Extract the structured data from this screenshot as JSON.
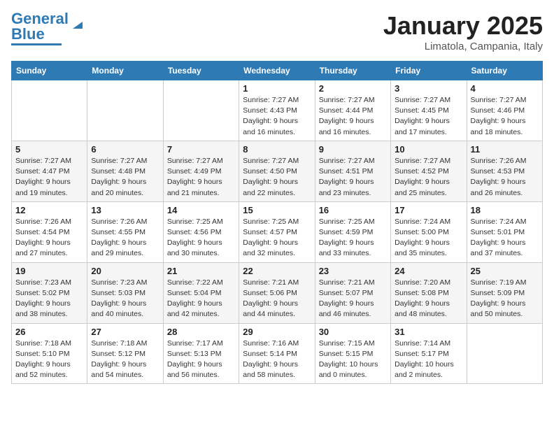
{
  "header": {
    "logo_line1": "General",
    "logo_line2": "Blue",
    "month": "January 2025",
    "location": "Limatola, Campania, Italy"
  },
  "weekdays": [
    "Sunday",
    "Monday",
    "Tuesday",
    "Wednesday",
    "Thursday",
    "Friday",
    "Saturday"
  ],
  "weeks": [
    [
      {
        "day": "",
        "sunrise": "",
        "sunset": "",
        "daylight": ""
      },
      {
        "day": "",
        "sunrise": "",
        "sunset": "",
        "daylight": ""
      },
      {
        "day": "",
        "sunrise": "",
        "sunset": "",
        "daylight": ""
      },
      {
        "day": "1",
        "sunrise": "Sunrise: 7:27 AM",
        "sunset": "Sunset: 4:43 PM",
        "daylight": "Daylight: 9 hours and 16 minutes."
      },
      {
        "day": "2",
        "sunrise": "Sunrise: 7:27 AM",
        "sunset": "Sunset: 4:44 PM",
        "daylight": "Daylight: 9 hours and 16 minutes."
      },
      {
        "day": "3",
        "sunrise": "Sunrise: 7:27 AM",
        "sunset": "Sunset: 4:45 PM",
        "daylight": "Daylight: 9 hours and 17 minutes."
      },
      {
        "day": "4",
        "sunrise": "Sunrise: 7:27 AM",
        "sunset": "Sunset: 4:46 PM",
        "daylight": "Daylight: 9 hours and 18 minutes."
      }
    ],
    [
      {
        "day": "5",
        "sunrise": "Sunrise: 7:27 AM",
        "sunset": "Sunset: 4:47 PM",
        "daylight": "Daylight: 9 hours and 19 minutes."
      },
      {
        "day": "6",
        "sunrise": "Sunrise: 7:27 AM",
        "sunset": "Sunset: 4:48 PM",
        "daylight": "Daylight: 9 hours and 20 minutes."
      },
      {
        "day": "7",
        "sunrise": "Sunrise: 7:27 AM",
        "sunset": "Sunset: 4:49 PM",
        "daylight": "Daylight: 9 hours and 21 minutes."
      },
      {
        "day": "8",
        "sunrise": "Sunrise: 7:27 AM",
        "sunset": "Sunset: 4:50 PM",
        "daylight": "Daylight: 9 hours and 22 minutes."
      },
      {
        "day": "9",
        "sunrise": "Sunrise: 7:27 AM",
        "sunset": "Sunset: 4:51 PM",
        "daylight": "Daylight: 9 hours and 23 minutes."
      },
      {
        "day": "10",
        "sunrise": "Sunrise: 7:27 AM",
        "sunset": "Sunset: 4:52 PM",
        "daylight": "Daylight: 9 hours and 25 minutes."
      },
      {
        "day": "11",
        "sunrise": "Sunrise: 7:26 AM",
        "sunset": "Sunset: 4:53 PM",
        "daylight": "Daylight: 9 hours and 26 minutes."
      }
    ],
    [
      {
        "day": "12",
        "sunrise": "Sunrise: 7:26 AM",
        "sunset": "Sunset: 4:54 PM",
        "daylight": "Daylight: 9 hours and 27 minutes."
      },
      {
        "day": "13",
        "sunrise": "Sunrise: 7:26 AM",
        "sunset": "Sunset: 4:55 PM",
        "daylight": "Daylight: 9 hours and 29 minutes."
      },
      {
        "day": "14",
        "sunrise": "Sunrise: 7:25 AM",
        "sunset": "Sunset: 4:56 PM",
        "daylight": "Daylight: 9 hours and 30 minutes."
      },
      {
        "day": "15",
        "sunrise": "Sunrise: 7:25 AM",
        "sunset": "Sunset: 4:57 PM",
        "daylight": "Daylight: 9 hours and 32 minutes."
      },
      {
        "day": "16",
        "sunrise": "Sunrise: 7:25 AM",
        "sunset": "Sunset: 4:59 PM",
        "daylight": "Daylight: 9 hours and 33 minutes."
      },
      {
        "day": "17",
        "sunrise": "Sunrise: 7:24 AM",
        "sunset": "Sunset: 5:00 PM",
        "daylight": "Daylight: 9 hours and 35 minutes."
      },
      {
        "day": "18",
        "sunrise": "Sunrise: 7:24 AM",
        "sunset": "Sunset: 5:01 PM",
        "daylight": "Daylight: 9 hours and 37 minutes."
      }
    ],
    [
      {
        "day": "19",
        "sunrise": "Sunrise: 7:23 AM",
        "sunset": "Sunset: 5:02 PM",
        "daylight": "Daylight: 9 hours and 38 minutes."
      },
      {
        "day": "20",
        "sunrise": "Sunrise: 7:23 AM",
        "sunset": "Sunset: 5:03 PM",
        "daylight": "Daylight: 9 hours and 40 minutes."
      },
      {
        "day": "21",
        "sunrise": "Sunrise: 7:22 AM",
        "sunset": "Sunset: 5:04 PM",
        "daylight": "Daylight: 9 hours and 42 minutes."
      },
      {
        "day": "22",
        "sunrise": "Sunrise: 7:21 AM",
        "sunset": "Sunset: 5:06 PM",
        "daylight": "Daylight: 9 hours and 44 minutes."
      },
      {
        "day": "23",
        "sunrise": "Sunrise: 7:21 AM",
        "sunset": "Sunset: 5:07 PM",
        "daylight": "Daylight: 9 hours and 46 minutes."
      },
      {
        "day": "24",
        "sunrise": "Sunrise: 7:20 AM",
        "sunset": "Sunset: 5:08 PM",
        "daylight": "Daylight: 9 hours and 48 minutes."
      },
      {
        "day": "25",
        "sunrise": "Sunrise: 7:19 AM",
        "sunset": "Sunset: 5:09 PM",
        "daylight": "Daylight: 9 hours and 50 minutes."
      }
    ],
    [
      {
        "day": "26",
        "sunrise": "Sunrise: 7:18 AM",
        "sunset": "Sunset: 5:10 PM",
        "daylight": "Daylight: 9 hours and 52 minutes."
      },
      {
        "day": "27",
        "sunrise": "Sunrise: 7:18 AM",
        "sunset": "Sunset: 5:12 PM",
        "daylight": "Daylight: 9 hours and 54 minutes."
      },
      {
        "day": "28",
        "sunrise": "Sunrise: 7:17 AM",
        "sunset": "Sunset: 5:13 PM",
        "daylight": "Daylight: 9 hours and 56 minutes."
      },
      {
        "day": "29",
        "sunrise": "Sunrise: 7:16 AM",
        "sunset": "Sunset: 5:14 PM",
        "daylight": "Daylight: 9 hours and 58 minutes."
      },
      {
        "day": "30",
        "sunrise": "Sunrise: 7:15 AM",
        "sunset": "Sunset: 5:15 PM",
        "daylight": "Daylight: 10 hours and 0 minutes."
      },
      {
        "day": "31",
        "sunrise": "Sunrise: 7:14 AM",
        "sunset": "Sunset: 5:17 PM",
        "daylight": "Daylight: 10 hours and 2 minutes."
      },
      {
        "day": "",
        "sunrise": "",
        "sunset": "",
        "daylight": ""
      }
    ]
  ]
}
